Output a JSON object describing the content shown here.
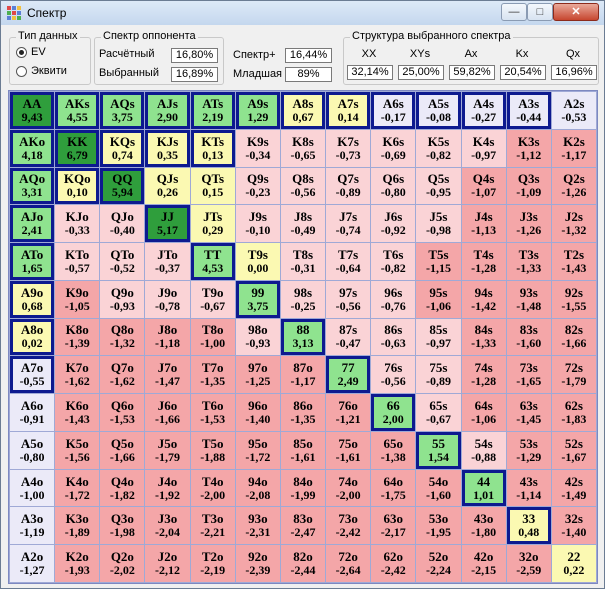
{
  "window": {
    "title": "Спектр",
    "buttons": {
      "minimize": "—",
      "maximize": "□",
      "close": "✕"
    },
    "icon": "grid-app-icon"
  },
  "data_type": {
    "label": "Тип данных",
    "options": [
      "EV",
      "Эквити"
    ],
    "selected": "EV"
  },
  "opponent": {
    "label": "Спектр оппонента",
    "calculated_label": "Расчётный",
    "calculated_value": "16,80%",
    "selected_label": "Выбранный",
    "selected_value": "16,89%"
  },
  "spectrum": {
    "plus_label": "Спектр+",
    "plus_value": "16,44%",
    "junior_label": "Младшая",
    "junior_value": "89%"
  },
  "structure": {
    "label": "Структура выбранного спектра",
    "headers": [
      "XX",
      "XYs",
      "Ax",
      "Kx",
      "Qx"
    ],
    "values": [
      "32,14%",
      "25,00%",
      "59,82%",
      "20,54%",
      "16,96%"
    ]
  },
  "colors": {
    "dark_green": "#2f9e3c",
    "light_green": "#8fe38f",
    "light_yellow": "#fbf9b2",
    "pale_blue": "#ebeaf8",
    "light_pink": "#fad3d6",
    "pink": "#f4a6a8",
    "salmon": "#ee8e8f",
    "selected_border": "#0d1a8f"
  },
  "hands": [
    [
      {
        "h": "AA",
        "v": "9,43",
        "c": "dark_green",
        "s": 1
      },
      {
        "h": "AKs",
        "v": "4,55",
        "c": "light_green",
        "s": 1
      },
      {
        "h": "AQs",
        "v": "3,75",
        "c": "light_green",
        "s": 1
      },
      {
        "h": "AJs",
        "v": "2,90",
        "c": "light_green",
        "s": 1
      },
      {
        "h": "ATs",
        "v": "2,19",
        "c": "light_green",
        "s": 1
      },
      {
        "h": "A9s",
        "v": "1,29",
        "c": "light_green",
        "s": 1
      },
      {
        "h": "A8s",
        "v": "0,67",
        "c": "light_yellow",
        "s": 1
      },
      {
        "h": "A7s",
        "v": "0,14",
        "c": "light_yellow",
        "s": 1
      },
      {
        "h": "A6s",
        "v": "-0,17",
        "c": "pale_blue",
        "s": 1
      },
      {
        "h": "A5s",
        "v": "-0,08",
        "c": "pale_blue",
        "s": 1
      },
      {
        "h": "A4s",
        "v": "-0,27",
        "c": "pale_blue",
        "s": 1
      },
      {
        "h": "A3s",
        "v": "-0,44",
        "c": "pale_blue",
        "s": 1
      },
      {
        "h": "A2s",
        "v": "-0,53",
        "c": "pale_blue",
        "s": 0
      }
    ],
    [
      {
        "h": "AKo",
        "v": "4,18",
        "c": "light_green",
        "s": 1
      },
      {
        "h": "KK",
        "v": "6,79",
        "c": "dark_green",
        "s": 1
      },
      {
        "h": "KQs",
        "v": "0,74",
        "c": "light_yellow",
        "s": 1
      },
      {
        "h": "KJs",
        "v": "0,35",
        "c": "light_yellow",
        "s": 1
      },
      {
        "h": "KTs",
        "v": "0,13",
        "c": "light_yellow",
        "s": 1
      },
      {
        "h": "K9s",
        "v": "-0,34",
        "c": "light_pink",
        "s": 0
      },
      {
        "h": "K8s",
        "v": "-0,65",
        "c": "light_pink",
        "s": 0
      },
      {
        "h": "K7s",
        "v": "-0,73",
        "c": "light_pink",
        "s": 0
      },
      {
        "h": "K6s",
        "v": "-0,69",
        "c": "light_pink",
        "s": 0
      },
      {
        "h": "K5s",
        "v": "-0,82",
        "c": "light_pink",
        "s": 0
      },
      {
        "h": "K4s",
        "v": "-0,97",
        "c": "light_pink",
        "s": 0
      },
      {
        "h": "K3s",
        "v": "-1,12",
        "c": "pink",
        "s": 0
      },
      {
        "h": "K2s",
        "v": "-1,17",
        "c": "pink",
        "s": 0
      }
    ],
    [
      {
        "h": "AQo",
        "v": "3,31",
        "c": "light_green",
        "s": 1
      },
      {
        "h": "KQo",
        "v": "0,10",
        "c": "light_yellow",
        "s": 1
      },
      {
        "h": "QQ",
        "v": "5,94",
        "c": "dark_green",
        "s": 1
      },
      {
        "h": "QJs",
        "v": "0,26",
        "c": "light_yellow",
        "s": 0
      },
      {
        "h": "QTs",
        "v": "0,15",
        "c": "light_yellow",
        "s": 0
      },
      {
        "h": "Q9s",
        "v": "-0,23",
        "c": "light_pink",
        "s": 0
      },
      {
        "h": "Q8s",
        "v": "-0,56",
        "c": "light_pink",
        "s": 0
      },
      {
        "h": "Q7s",
        "v": "-0,89",
        "c": "light_pink",
        "s": 0
      },
      {
        "h": "Q6s",
        "v": "-0,80",
        "c": "light_pink",
        "s": 0
      },
      {
        "h": "Q5s",
        "v": "-0,95",
        "c": "light_pink",
        "s": 0
      },
      {
        "h": "Q4s",
        "v": "-1,07",
        "c": "pink",
        "s": 0
      },
      {
        "h": "Q3s",
        "v": "-1,09",
        "c": "pink",
        "s": 0
      },
      {
        "h": "Q2s",
        "v": "-1,26",
        "c": "pink",
        "s": 0
      }
    ],
    [
      {
        "h": "AJo",
        "v": "2,41",
        "c": "light_green",
        "s": 1
      },
      {
        "h": "KJo",
        "v": "-0,33",
        "c": "light_pink",
        "s": 0
      },
      {
        "h": "QJo",
        "v": "-0,40",
        "c": "light_pink",
        "s": 0
      },
      {
        "h": "JJ",
        "v": "5,17",
        "c": "dark_green",
        "s": 1
      },
      {
        "h": "JTs",
        "v": "0,29",
        "c": "light_yellow",
        "s": 0
      },
      {
        "h": "J9s",
        "v": "-0,10",
        "c": "light_pink",
        "s": 0
      },
      {
        "h": "J8s",
        "v": "-0,49",
        "c": "light_pink",
        "s": 0
      },
      {
        "h": "J7s",
        "v": "-0,74",
        "c": "light_pink",
        "s": 0
      },
      {
        "h": "J6s",
        "v": "-0,92",
        "c": "light_pink",
        "s": 0
      },
      {
        "h": "J5s",
        "v": "-0,98",
        "c": "light_pink",
        "s": 0
      },
      {
        "h": "J4s",
        "v": "-1,13",
        "c": "pink",
        "s": 0
      },
      {
        "h": "J3s",
        "v": "-1,26",
        "c": "pink",
        "s": 0
      },
      {
        "h": "J2s",
        "v": "-1,32",
        "c": "pink",
        "s": 0
      }
    ],
    [
      {
        "h": "ATo",
        "v": "1,65",
        "c": "light_green",
        "s": 1
      },
      {
        "h": "KTo",
        "v": "-0,57",
        "c": "light_pink",
        "s": 0
      },
      {
        "h": "QTo",
        "v": "-0,52",
        "c": "light_pink",
        "s": 0
      },
      {
        "h": "JTo",
        "v": "-0,37",
        "c": "light_pink",
        "s": 0
      },
      {
        "h": "TT",
        "v": "4,53",
        "c": "light_green",
        "s": 1
      },
      {
        "h": "T9s",
        "v": "0,00",
        "c": "light_yellow",
        "s": 0
      },
      {
        "h": "T8s",
        "v": "-0,31",
        "c": "light_pink",
        "s": 0
      },
      {
        "h": "T7s",
        "v": "-0,64",
        "c": "light_pink",
        "s": 0
      },
      {
        "h": "T6s",
        "v": "-0,82",
        "c": "light_pink",
        "s": 0
      },
      {
        "h": "T5s",
        "v": "-1,15",
        "c": "pink",
        "s": 0
      },
      {
        "h": "T4s",
        "v": "-1,28",
        "c": "pink",
        "s": 0
      },
      {
        "h": "T3s",
        "v": "-1,33",
        "c": "pink",
        "s": 0
      },
      {
        "h": "T2s",
        "v": "-1,43",
        "c": "pink",
        "s": 0
      }
    ],
    [
      {
        "h": "A9o",
        "v": "0,68",
        "c": "light_yellow",
        "s": 1
      },
      {
        "h": "K9o",
        "v": "-1,05",
        "c": "pink",
        "s": 0
      },
      {
        "h": "Q9o",
        "v": "-0,93",
        "c": "light_pink",
        "s": 0
      },
      {
        "h": "J9o",
        "v": "-0,78",
        "c": "light_pink",
        "s": 0
      },
      {
        "h": "T9o",
        "v": "-0,67",
        "c": "light_pink",
        "s": 0
      },
      {
        "h": "99",
        "v": "3,75",
        "c": "light_green",
        "s": 1
      },
      {
        "h": "98s",
        "v": "-0,25",
        "c": "light_pink",
        "s": 0
      },
      {
        "h": "97s",
        "v": "-0,56",
        "c": "light_pink",
        "s": 0
      },
      {
        "h": "96s",
        "v": "-0,76",
        "c": "light_pink",
        "s": 0
      },
      {
        "h": "95s",
        "v": "-1,06",
        "c": "pink",
        "s": 0
      },
      {
        "h": "94s",
        "v": "-1,42",
        "c": "pink",
        "s": 0
      },
      {
        "h": "93s",
        "v": "-1,48",
        "c": "pink",
        "s": 0
      },
      {
        "h": "92s",
        "v": "-1,55",
        "c": "pink",
        "s": 0
      }
    ],
    [
      {
        "h": "A8o",
        "v": "0,02",
        "c": "light_yellow",
        "s": 1
      },
      {
        "h": "K8o",
        "v": "-1,39",
        "c": "pink",
        "s": 0
      },
      {
        "h": "Q8o",
        "v": "-1,32",
        "c": "pink",
        "s": 0
      },
      {
        "h": "J8o",
        "v": "-1,18",
        "c": "pink",
        "s": 0
      },
      {
        "h": "T8o",
        "v": "-1,00",
        "c": "pink",
        "s": 0
      },
      {
        "h": "98o",
        "v": "-0,93",
        "c": "light_pink",
        "s": 0
      },
      {
        "h": "88",
        "v": "3,13",
        "c": "light_green",
        "s": 1
      },
      {
        "h": "87s",
        "v": "-0,47",
        "c": "light_pink",
        "s": 0
      },
      {
        "h": "86s",
        "v": "-0,63",
        "c": "light_pink",
        "s": 0
      },
      {
        "h": "85s",
        "v": "-0,97",
        "c": "light_pink",
        "s": 0
      },
      {
        "h": "84s",
        "v": "-1,33",
        "c": "pink",
        "s": 0
      },
      {
        "h": "83s",
        "v": "-1,60",
        "c": "pink",
        "s": 0
      },
      {
        "h": "82s",
        "v": "-1,66",
        "c": "pink",
        "s": 0
      }
    ],
    [
      {
        "h": "A7o",
        "v": "-0,55",
        "c": "pale_blue",
        "s": 1
      },
      {
        "h": "K7o",
        "v": "-1,62",
        "c": "pink",
        "s": 0
      },
      {
        "h": "Q7o",
        "v": "-1,62",
        "c": "pink",
        "s": 0
      },
      {
        "h": "J7o",
        "v": "-1,47",
        "c": "pink",
        "s": 0
      },
      {
        "h": "T7o",
        "v": "-1,35",
        "c": "pink",
        "s": 0
      },
      {
        "h": "97o",
        "v": "-1,25",
        "c": "pink",
        "s": 0
      },
      {
        "h": "87o",
        "v": "-1,17",
        "c": "pink",
        "s": 0
      },
      {
        "h": "77",
        "v": "2,49",
        "c": "light_green",
        "s": 1
      },
      {
        "h": "76s",
        "v": "-0,56",
        "c": "light_pink",
        "s": 0
      },
      {
        "h": "75s",
        "v": "-0,89",
        "c": "light_pink",
        "s": 0
      },
      {
        "h": "74s",
        "v": "-1,28",
        "c": "pink",
        "s": 0
      },
      {
        "h": "73s",
        "v": "-1,65",
        "c": "pink",
        "s": 0
      },
      {
        "h": "72s",
        "v": "-1,79",
        "c": "pink",
        "s": 0
      }
    ],
    [
      {
        "h": "A6o",
        "v": "-0,91",
        "c": "pale_blue",
        "s": 0
      },
      {
        "h": "K6o",
        "v": "-1,43",
        "c": "pink",
        "s": 0
      },
      {
        "h": "Q6o",
        "v": "-1,53",
        "c": "pink",
        "s": 0
      },
      {
        "h": "J6o",
        "v": "-1,66",
        "c": "pink",
        "s": 0
      },
      {
        "h": "T6o",
        "v": "-1,53",
        "c": "pink",
        "s": 0
      },
      {
        "h": "96o",
        "v": "-1,40",
        "c": "pink",
        "s": 0
      },
      {
        "h": "86o",
        "v": "-1,35",
        "c": "pink",
        "s": 0
      },
      {
        "h": "76o",
        "v": "-1,21",
        "c": "pink",
        "s": 0
      },
      {
        "h": "66",
        "v": "2,00",
        "c": "light_green",
        "s": 1
      },
      {
        "h": "65s",
        "v": "-0,67",
        "c": "light_pink",
        "s": 0
      },
      {
        "h": "64s",
        "v": "-1,06",
        "c": "pink",
        "s": 0
      },
      {
        "h": "63s",
        "v": "-1,45",
        "c": "pink",
        "s": 0
      },
      {
        "h": "62s",
        "v": "-1,83",
        "c": "pink",
        "s": 0
      }
    ],
    [
      {
        "h": "A5o",
        "v": "-0,80",
        "c": "pale_blue",
        "s": 0
      },
      {
        "h": "K5o",
        "v": "-1,56",
        "c": "pink",
        "s": 0
      },
      {
        "h": "Q5o",
        "v": "-1,66",
        "c": "pink",
        "s": 0
      },
      {
        "h": "J5o",
        "v": "-1,79",
        "c": "pink",
        "s": 0
      },
      {
        "h": "T5o",
        "v": "-1,88",
        "c": "pink",
        "s": 0
      },
      {
        "h": "95o",
        "v": "-1,72",
        "c": "pink",
        "s": 0
      },
      {
        "h": "85o",
        "v": "-1,61",
        "c": "pink",
        "s": 0
      },
      {
        "h": "75o",
        "v": "-1,61",
        "c": "pink",
        "s": 0
      },
      {
        "h": "65o",
        "v": "-1,38",
        "c": "pink",
        "s": 0
      },
      {
        "h": "55",
        "v": "1,54",
        "c": "light_green",
        "s": 1
      },
      {
        "h": "54s",
        "v": "-0,88",
        "c": "light_pink",
        "s": 0
      },
      {
        "h": "53s",
        "v": "-1,29",
        "c": "pink",
        "s": 0
      },
      {
        "h": "52s",
        "v": "-1,67",
        "c": "pink",
        "s": 0
      }
    ],
    [
      {
        "h": "A4o",
        "v": "-1,00",
        "c": "pale_blue",
        "s": 0
      },
      {
        "h": "K4o",
        "v": "-1,72",
        "c": "pink",
        "s": 0
      },
      {
        "h": "Q4o",
        "v": "-1,82",
        "c": "pink",
        "s": 0
      },
      {
        "h": "J4o",
        "v": "-1,92",
        "c": "pink",
        "s": 0
      },
      {
        "h": "T4o",
        "v": "-2,00",
        "c": "pink",
        "s": 0
      },
      {
        "h": "94o",
        "v": "-2,08",
        "c": "pink",
        "s": 0
      },
      {
        "h": "84o",
        "v": "-1,99",
        "c": "pink",
        "s": 0
      },
      {
        "h": "74o",
        "v": "-2,00",
        "c": "pink",
        "s": 0
      },
      {
        "h": "64o",
        "v": "-1,75",
        "c": "pink",
        "s": 0
      },
      {
        "h": "54o",
        "v": "-1,60",
        "c": "pink",
        "s": 0
      },
      {
        "h": "44",
        "v": "1,01",
        "c": "light_green",
        "s": 1
      },
      {
        "h": "43s",
        "v": "-1,14",
        "c": "pink",
        "s": 0
      },
      {
        "h": "42s",
        "v": "-1,49",
        "c": "pink",
        "s": 0
      }
    ],
    [
      {
        "h": "A3o",
        "v": "-1,19",
        "c": "pale_blue",
        "s": 0
      },
      {
        "h": "K3o",
        "v": "-1,89",
        "c": "pink",
        "s": 0
      },
      {
        "h": "Q3o",
        "v": "-1,98",
        "c": "pink",
        "s": 0
      },
      {
        "h": "J3o",
        "v": "-2,04",
        "c": "pink",
        "s": 0
      },
      {
        "h": "T3o",
        "v": "-2,21",
        "c": "pink",
        "s": 0
      },
      {
        "h": "93o",
        "v": "-2,31",
        "c": "pink",
        "s": 0
      },
      {
        "h": "83o",
        "v": "-2,47",
        "c": "pink",
        "s": 0
      },
      {
        "h": "73o",
        "v": "-2,42",
        "c": "pink",
        "s": 0
      },
      {
        "h": "63o",
        "v": "-2,17",
        "c": "pink",
        "s": 0
      },
      {
        "h": "53o",
        "v": "-1,95",
        "c": "pink",
        "s": 0
      },
      {
        "h": "43o",
        "v": "-1,80",
        "c": "pink",
        "s": 0
      },
      {
        "h": "33",
        "v": "0,48",
        "c": "light_yellow",
        "s": 1
      },
      {
        "h": "32s",
        "v": "-1,40",
        "c": "pink",
        "s": 0
      }
    ],
    [
      {
        "h": "A2o",
        "v": "-1,27",
        "c": "pale_blue",
        "s": 0
      },
      {
        "h": "K2o",
        "v": "-1,93",
        "c": "pink",
        "s": 0
      },
      {
        "h": "Q2o",
        "v": "-2,02",
        "c": "pink",
        "s": 0
      },
      {
        "h": "J2o",
        "v": "-2,12",
        "c": "pink",
        "s": 0
      },
      {
        "h": "T2o",
        "v": "-2,19",
        "c": "pink",
        "s": 0
      },
      {
        "h": "92o",
        "v": "-2,39",
        "c": "pink",
        "s": 0
      },
      {
        "h": "82o",
        "v": "-2,44",
        "c": "pink",
        "s": 0
      },
      {
        "h": "72o",
        "v": "-2,64",
        "c": "pink",
        "s": 0
      },
      {
        "h": "62o",
        "v": "-2,42",
        "c": "pink",
        "s": 0
      },
      {
        "h": "52o",
        "v": "-2,24",
        "c": "pink",
        "s": 0
      },
      {
        "h": "42o",
        "v": "-2,15",
        "c": "pink",
        "s": 0
      },
      {
        "h": "32o",
        "v": "-2,59",
        "c": "pink",
        "s": 0
      },
      {
        "h": "22",
        "v": "0,22",
        "c": "light_yellow",
        "s": 0
      }
    ]
  ]
}
